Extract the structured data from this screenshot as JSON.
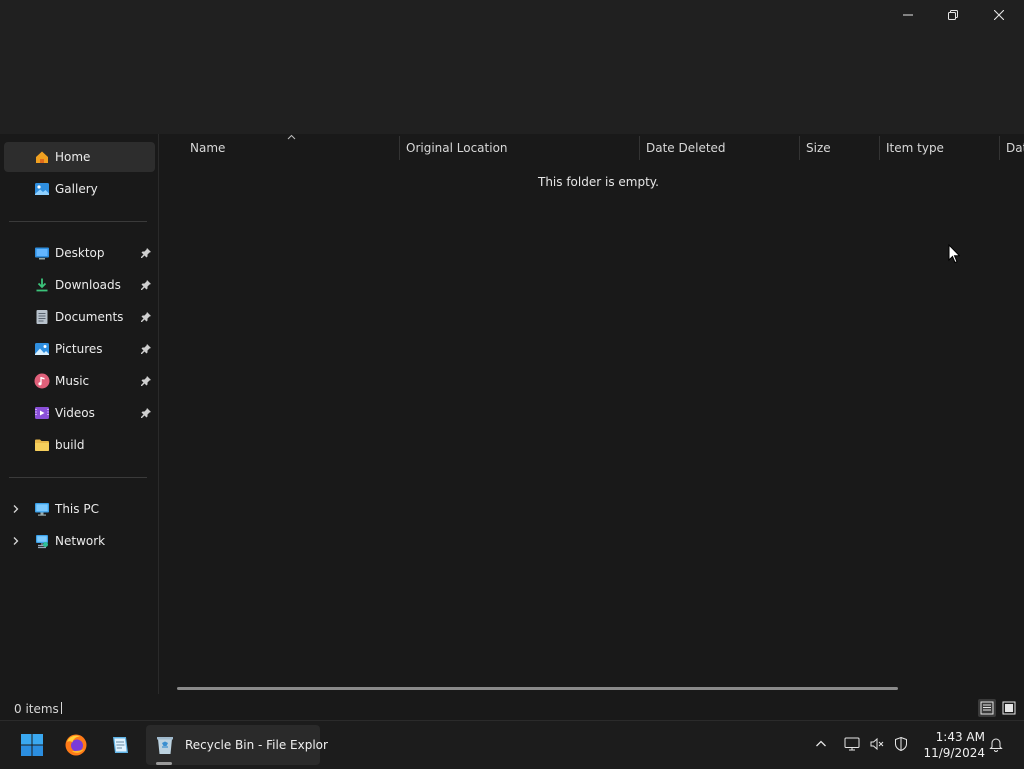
{
  "window": {
    "title": "Recycle Bin - File Explorer",
    "controls": [
      "minimize",
      "restore",
      "close"
    ]
  },
  "sidebar": {
    "items": [
      {
        "label": "Home",
        "icon": "home-icon",
        "selected": true
      },
      {
        "label": "Gallery",
        "icon": "gallery-icon"
      },
      {
        "label": "Desktop",
        "icon": "desktop-icon",
        "pinned": true
      },
      {
        "label": "Downloads",
        "icon": "downloads-icon",
        "pinned": true
      },
      {
        "label": "Documents",
        "icon": "documents-icon",
        "pinned": true
      },
      {
        "label": "Pictures",
        "icon": "pictures-icon",
        "pinned": true
      },
      {
        "label": "Music",
        "icon": "music-icon",
        "pinned": true
      },
      {
        "label": "Videos",
        "icon": "videos-icon",
        "pinned": true
      },
      {
        "label": "build",
        "icon": "folder-icon"
      },
      {
        "label": "This PC",
        "icon": "this-pc-icon",
        "expandable": true
      },
      {
        "label": "Network",
        "icon": "network-icon",
        "expandable": true
      }
    ]
  },
  "content": {
    "columns": [
      "Name",
      "Original Location",
      "Date Deleted",
      "Size",
      "Item type",
      "Dat"
    ],
    "sort_column": "Name",
    "empty_message": "This folder is empty."
  },
  "statusbar": {
    "items_count": "0 items"
  },
  "taskbar": {
    "pinned": [
      "start-icon",
      "firefox-icon",
      "notepad-icon"
    ],
    "active_app_label": "Recycle Bin - File Explor",
    "tray_icons": [
      "chevron-up-icon",
      "monitor-icon",
      "volume-muted-icon",
      "shield-icon",
      "bell-icon"
    ]
  },
  "clock": {
    "time": "1:43 AM",
    "date": "11/9/2024"
  },
  "colors": {
    "window_bg": "#191919",
    "titlebar_bg": "#202020",
    "taskbar_bg": "#1c1c1c",
    "selected_bg": "#2d2d2d",
    "windows_blue": "#0078d4"
  }
}
